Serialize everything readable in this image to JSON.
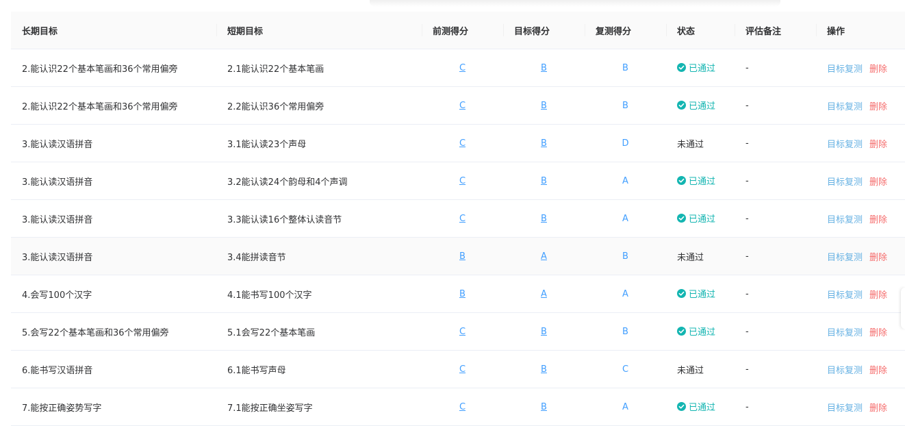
{
  "table": {
    "headers": {
      "long_goal": "长期目标",
      "short_goal": "短期目标",
      "pre_score": "前测得分",
      "target_score": "目标得分",
      "re_score": "复测得分",
      "status": "状态",
      "note": "评估备注",
      "ops": "操作"
    },
    "rows": [
      {
        "long_goal": "2.能认识22个基本笔画和36个常用偏旁",
        "short_goal": "2.1能认识22个基本笔画",
        "pre_score": "C",
        "target_score": "B",
        "re_score": "B",
        "status": "已通过",
        "passed": true,
        "note": "-",
        "retest": "目标复测",
        "delete": "删除"
      },
      {
        "long_goal": "2.能认识22个基本笔画和36个常用偏旁",
        "short_goal": "2.2能认识36个常用偏旁",
        "pre_score": "C",
        "target_score": "B",
        "re_score": "B",
        "status": "已通过",
        "passed": true,
        "note": "-",
        "retest": "目标复测",
        "delete": "删除"
      },
      {
        "long_goal": "3.能认读汉语拼音",
        "short_goal": "3.1能认读23个声母",
        "pre_score": "C",
        "target_score": "B",
        "re_score": "D",
        "status": "未通过",
        "passed": false,
        "note": "-",
        "retest": "目标复测",
        "delete": "删除"
      },
      {
        "long_goal": "3.能认读汉语拼音",
        "short_goal": "3.2能认读24个韵母和4个声调",
        "pre_score": "C",
        "target_score": "B",
        "re_score": "A",
        "status": "已通过",
        "passed": true,
        "note": "-",
        "retest": "目标复测",
        "delete": "删除"
      },
      {
        "long_goal": "3.能认读汉语拼音",
        "short_goal": "3.3能认读16个整体认读音节",
        "pre_score": "C",
        "target_score": "B",
        "re_score": "A",
        "status": "已通过",
        "passed": true,
        "note": "-",
        "retest": "目标复测",
        "delete": "删除"
      },
      {
        "long_goal": "3.能认读汉语拼音",
        "short_goal": "3.4能拼读音节",
        "pre_score": "B",
        "target_score": "A",
        "re_score": "B",
        "status": "未通过",
        "passed": false,
        "note": "-",
        "retest": "目标复测",
        "delete": "删除"
      },
      {
        "long_goal": "4.会写100个汉字",
        "short_goal": "4.1能书写100个汉字",
        "pre_score": "B",
        "target_score": "A",
        "re_score": "A",
        "status": "已通过",
        "passed": true,
        "note": "-",
        "retest": "目标复测",
        "delete": "删除"
      },
      {
        "long_goal": "5.会写22个基本笔画和36个常用偏旁",
        "short_goal": "5.1会写22个基本笔画",
        "pre_score": "C",
        "target_score": "B",
        "re_score": "B",
        "status": "已通过",
        "passed": true,
        "note": "-",
        "retest": "目标复测",
        "delete": "删除"
      },
      {
        "long_goal": "6.能书写汉语拼音",
        "short_goal": "6.1能书写声母",
        "pre_score": "C",
        "target_score": "B",
        "re_score": "C",
        "status": "未通过",
        "passed": false,
        "note": "-",
        "retest": "目标复测",
        "delete": "删除"
      },
      {
        "long_goal": "7.能按正确姿势写字",
        "short_goal": "7.1能按正确坐姿写字",
        "pre_score": "C",
        "target_score": "B",
        "re_score": "A",
        "status": "已通过",
        "passed": true,
        "note": "-",
        "retest": "目标复测",
        "delete": "删除"
      }
    ]
  },
  "colors": {
    "link": "#409eff",
    "pass": "#13b5b1",
    "delete": "#f56c6c",
    "header_bg": "#fafafa"
  },
  "icons": {
    "pass": "check-circle-icon"
  }
}
